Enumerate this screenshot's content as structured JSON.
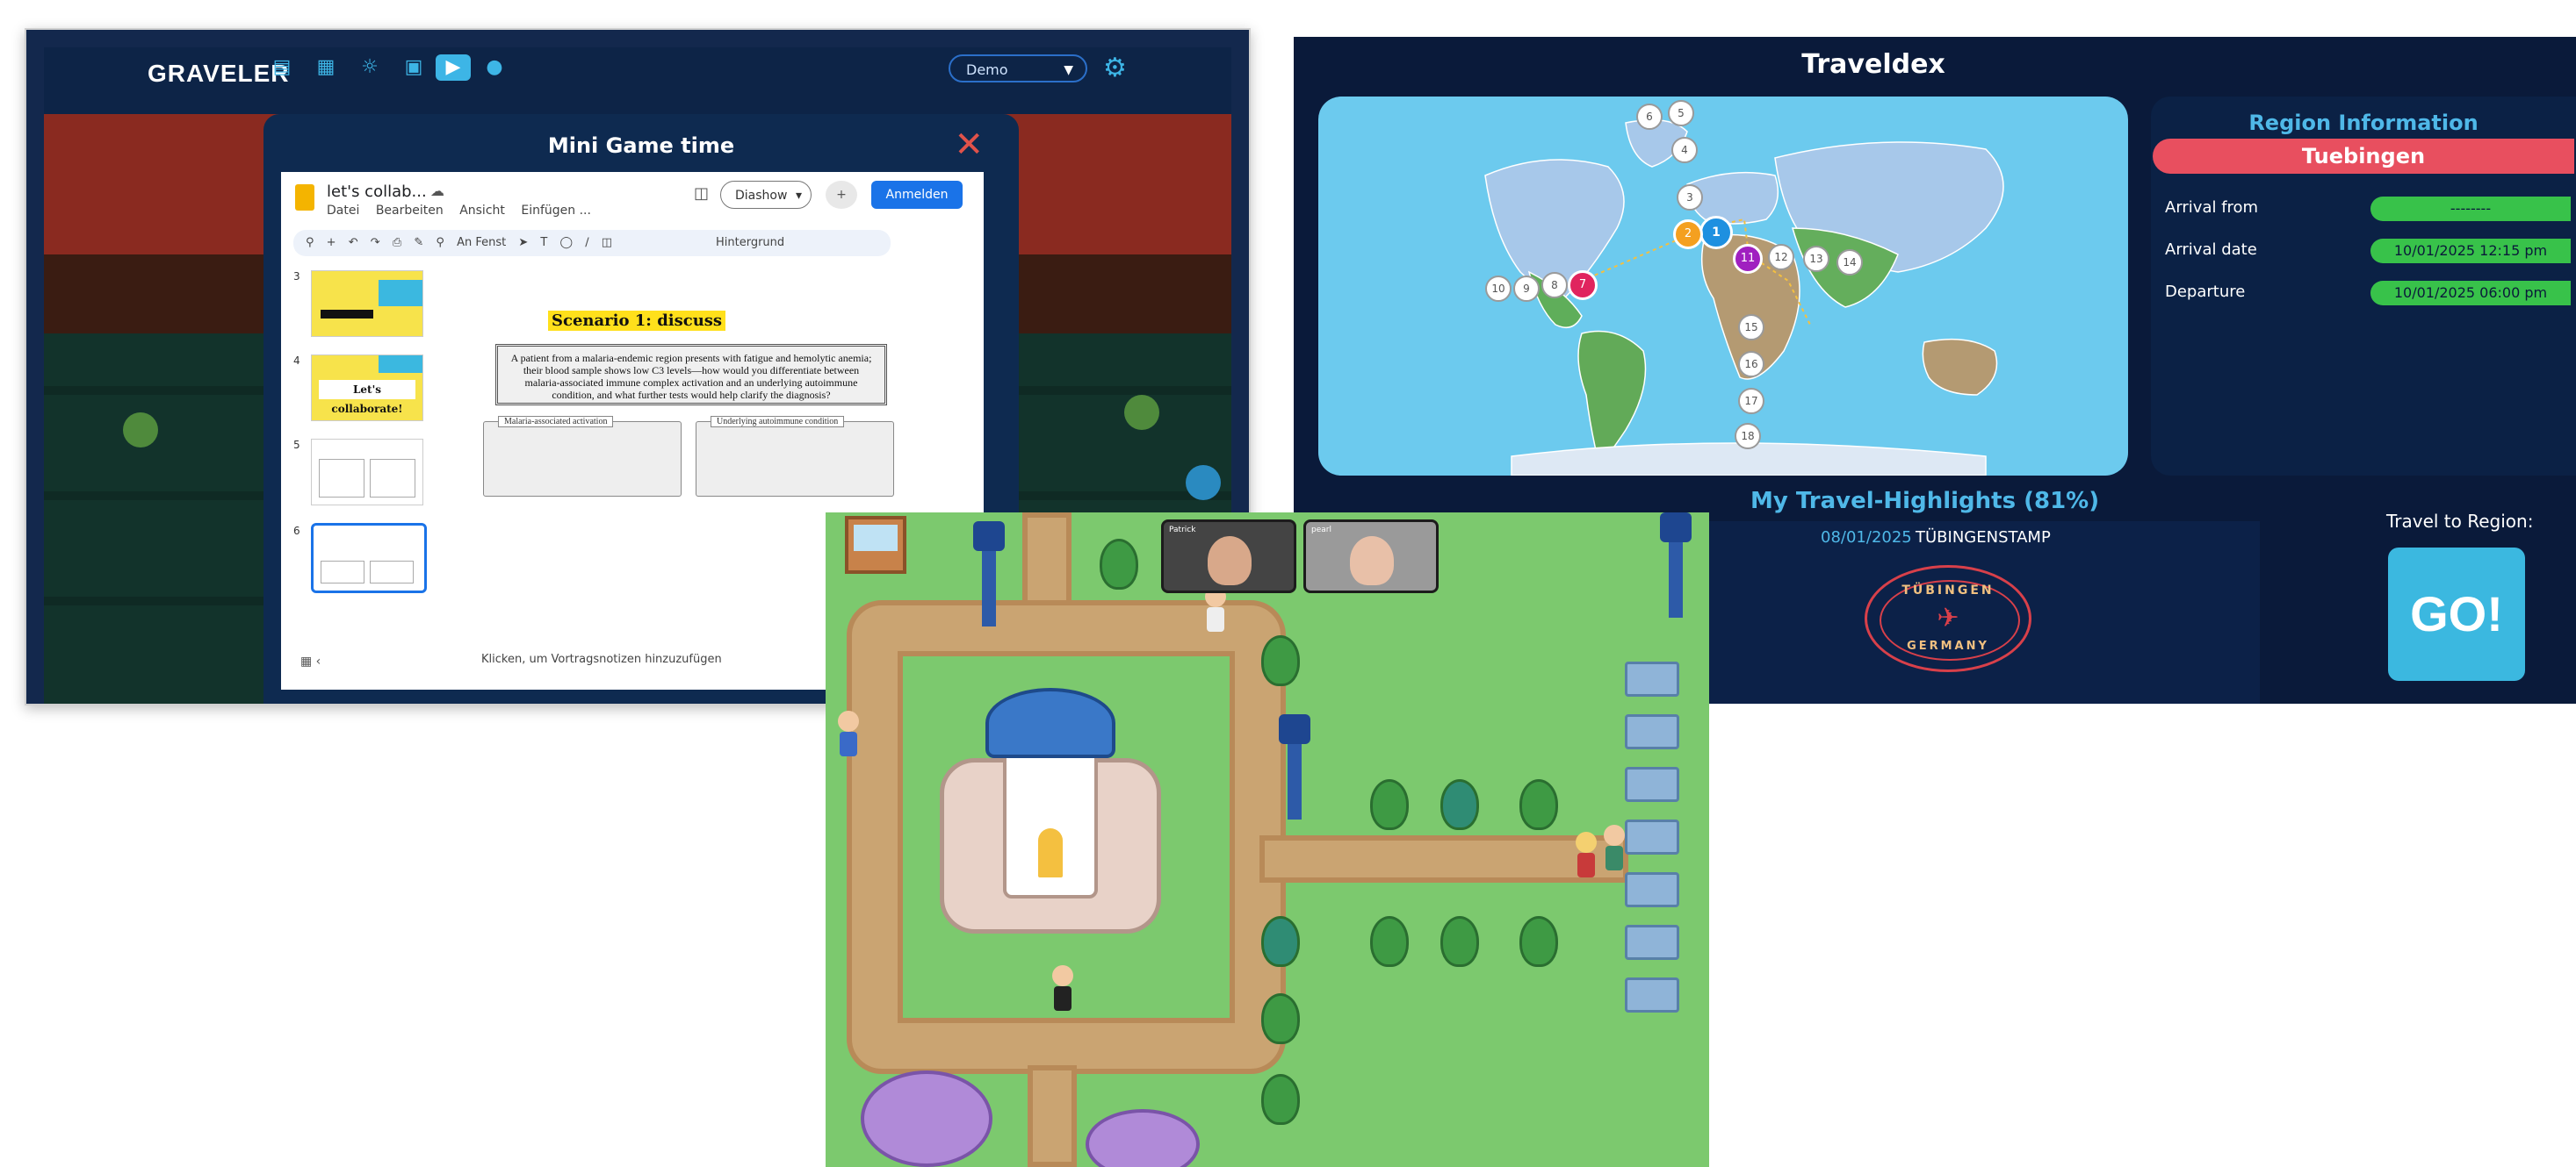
{
  "traveler": {
    "logo": "GRAVELER",
    "nav_icons": [
      "clipboard-icon",
      "chart-icon",
      "globe-icon",
      "calculator-icon",
      "gamepad-icon",
      "person-icon"
    ],
    "demo_select": "Demo",
    "modal_title": "Mini Game time",
    "docs": {
      "title": "let's collab...",
      "menu": [
        "Datei",
        "Bearbeiten",
        "Ansicht",
        "Einfügen ..."
      ],
      "diashow": "Diashow",
      "anmelden": "Anmelden",
      "zoom": "An Fenst",
      "hintergrund": "Hintergrund",
      "thumb_numbers": [
        "3",
        "4",
        "5",
        "6"
      ],
      "thumb4_text": "Let's collaborate!",
      "slide_title": "Scenario 1: discuss",
      "slide_body": "A patient from a malaria-endemic region presents with fatigue and hemolytic anemia; their blood sample shows low C3 levels—how would you differentiate between malaria-associated immune complex activation and an underlying autoimmune condition, and what further tests would help clarify the diagnosis?",
      "box1_label": "Malaria-associated activation",
      "box2_label": "Underlying autoimmune condition",
      "speaker_notes": "Klicken, um Vortragsnotizen hinzuzufügen"
    }
  },
  "traveldex": {
    "title": "Traveldex",
    "region_title": "Region Information",
    "region_name": "Tuebingen",
    "rows": [
      {
        "label": "Arrival from",
        "value": "--------"
      },
      {
        "label": "Arrival date",
        "value": "10/01/2025 12:15 pm"
      },
      {
        "label": "Departure",
        "value": "10/01/2025 06:00 pm"
      }
    ],
    "highlights_title": "My Travel-Highlights (81%)",
    "highlight_date": "08/01/2025",
    "highlight_name": "TÜBINGENSTAMP",
    "stamp_top": "TÜBINGEN",
    "stamp_bottom": "GERMANY",
    "travel_label": "Travel to Region:",
    "go_label": "GO!",
    "pins": [
      "1",
      "2",
      "3",
      "4",
      "5",
      "6",
      "7",
      "8",
      "9",
      "10",
      "11",
      "12",
      "13",
      "14",
      "15",
      "16",
      "17",
      "18"
    ]
  },
  "world": {
    "video_names": [
      "Patrick",
      "pearl"
    ]
  }
}
